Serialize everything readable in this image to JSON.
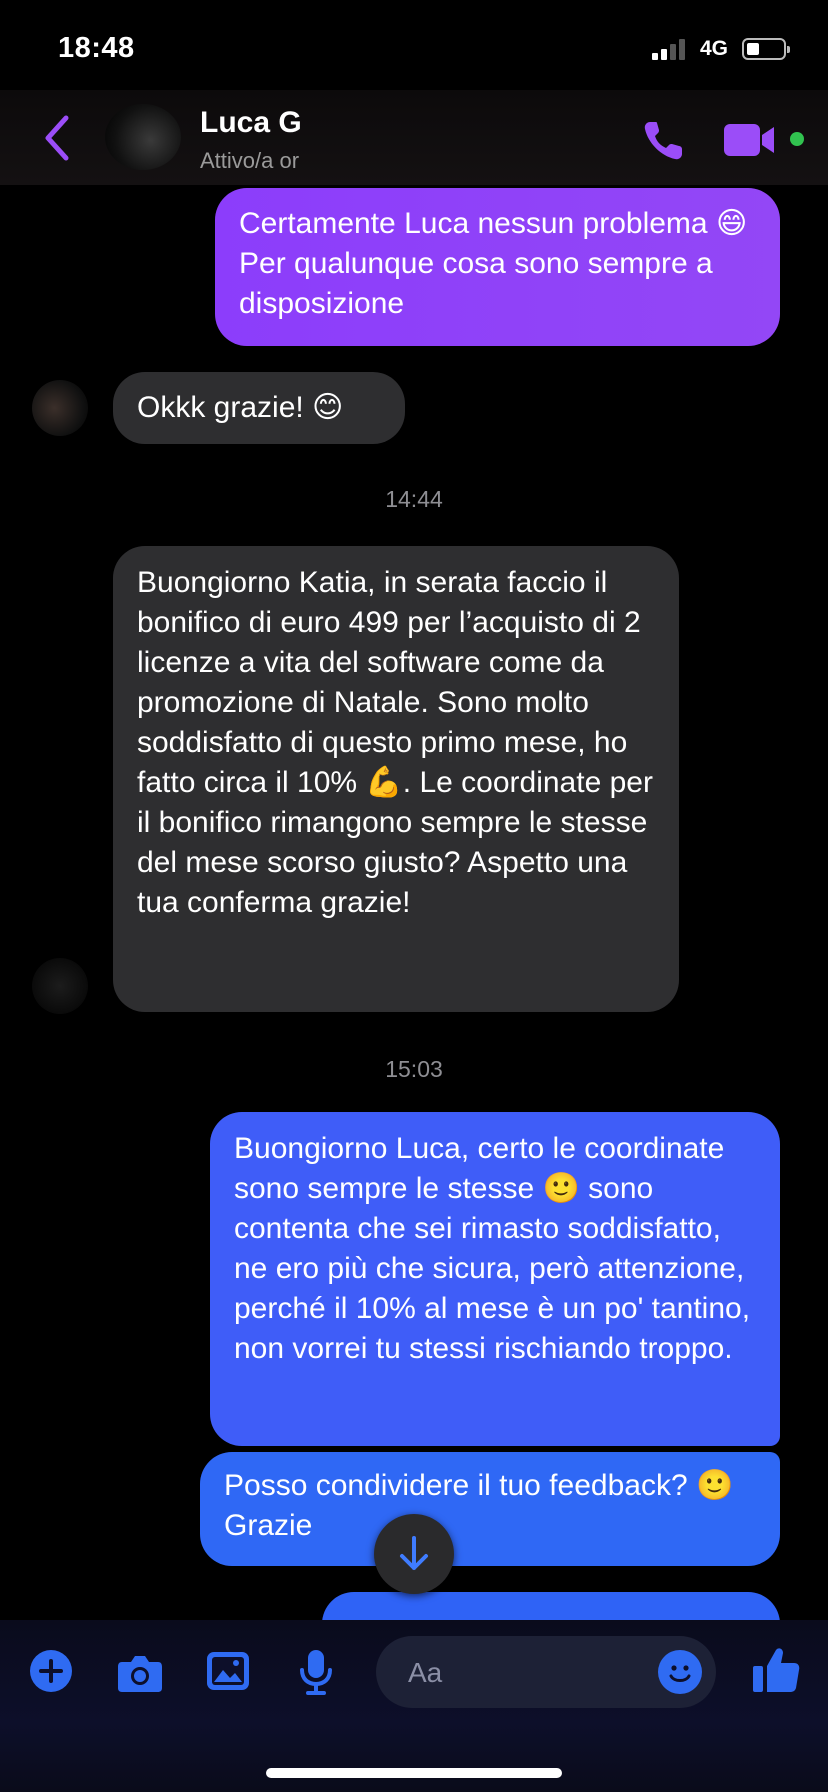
{
  "status_bar": {
    "time": "18:48",
    "network": "4G"
  },
  "header": {
    "contact_name": "Luca G",
    "contact_status": "Attivo/a or",
    "icons": [
      "back-icon",
      "phone-icon",
      "video-icon"
    ],
    "accent_color": "#9b4df8"
  },
  "messages": [
    {
      "direction": "outgoing",
      "text": "Certamente Luca nessun problema 😄 Per qualunque cosa sono sempre a disposizione"
    },
    {
      "direction": "incoming",
      "text": "Okkk grazie! 😊"
    },
    {
      "direction": "timestamp",
      "text": "14:44"
    },
    {
      "direction": "incoming",
      "text": "Buongiorno Katia, in serata faccio il bonifico di euro 499 per l’acquisto di 2 licenze a vita del software come da promozione di Natale. Sono molto soddisfatto di questo primo mese, ho fatto circa il 10% 💪. Le coordinate per il bonifico rimangono sempre le stesse del mese scorso giusto? Aspetto una tua  conferma grazie!"
    },
    {
      "direction": "timestamp",
      "text": "15:03"
    },
    {
      "direction": "outgoing",
      "text": "Buongiorno Luca, certo le coordinate sono sempre le stesse 🙂 sono contenta che sei rimasto soddisfatto, ne ero più che sicura, però attenzione, perché il 10% al mese è un po' tantino, non vorrei tu stessi rischiando troppo."
    },
    {
      "direction": "outgoing",
      "text": "Posso condividere il tuo feedback? 🙂 Grazie"
    }
  ],
  "composer": {
    "placeholder": "Aa",
    "icons": [
      "plus-icon",
      "camera-icon",
      "photo-icon",
      "mic-icon",
      "emoji-icon",
      "like-icon"
    ]
  },
  "colors": {
    "outgoing_purple": "#8c3dfb",
    "outgoing_blue": "#3f5df8",
    "incoming_gray": "#2e2e30",
    "icon_blue": "#2f6bf2"
  }
}
